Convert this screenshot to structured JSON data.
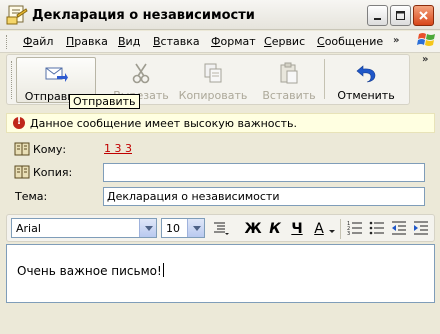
{
  "window": {
    "title": "Декларация о независимости"
  },
  "menu": {
    "items": [
      {
        "label": "Файл",
        "u": "Ф",
        "rest": "айл"
      },
      {
        "label": "Правка",
        "u": "П",
        "rest": "равка"
      },
      {
        "label": "Вид",
        "u": "В",
        "rest": "ид"
      },
      {
        "label": "Вставка",
        "u": "В",
        "rest": "ставка"
      },
      {
        "label": "Формат",
        "u": "Ф",
        "rest": "ормат"
      },
      {
        "label": "Сервис",
        "u": "С",
        "rest": "ервис"
      },
      {
        "label": "Сообщение",
        "u": "С",
        "rest": "ообщение"
      }
    ]
  },
  "toolbar": {
    "send_label": "Отправить",
    "cut_label": "Вырезать",
    "copy_label": "Копировать",
    "paste_label": "Вставить",
    "undo_label": "Отменить",
    "tooltip": "Отправить"
  },
  "infobar": {
    "text": "Данное сообщение имеет высокую важность."
  },
  "header": {
    "to_label": "Кому:",
    "to_value": "1 3 3",
    "cc_label": "Копия:",
    "cc_value": "",
    "subject_label": "Тема:",
    "subject_value": "Декларация о независимости"
  },
  "format": {
    "font": "Arial",
    "size": "10",
    "bold": "Ж",
    "italic": "К",
    "underline": "Ч",
    "font_color": "А"
  },
  "message": {
    "body": "Очень важное письмо!"
  },
  "colors": {
    "importance": "#c0281b",
    "recipient": "#c00000"
  }
}
